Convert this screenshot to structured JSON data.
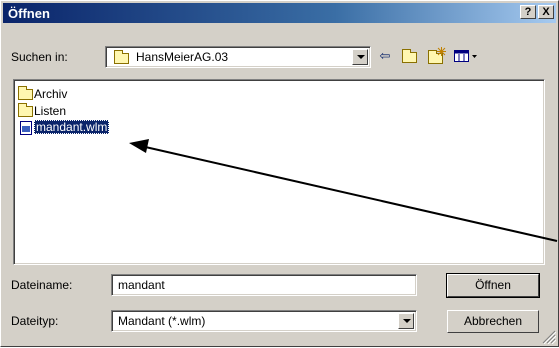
{
  "window": {
    "title": "Öffnen",
    "help_btn": "?",
    "close_btn": "X"
  },
  "lookin": {
    "label": "Suchen in:",
    "value": "HansMeierAG.03"
  },
  "toolbar": {
    "back_icon": "back-arrow-icon",
    "up_icon": "up-folder-icon",
    "new_folder_icon": "new-folder-icon",
    "view_icon": "view-menu-icon",
    "back_glyph": "⇦",
    "up_glyph": "⮤"
  },
  "files": [
    {
      "name": "Archiv",
      "type": "folder"
    },
    {
      "name": "Listen",
      "type": "folder"
    },
    {
      "name": "mandant.wlm",
      "type": "file",
      "selected": true
    }
  ],
  "filename": {
    "label": "Dateiname:",
    "value": "mandant"
  },
  "filetype": {
    "label": "Dateityp:",
    "value": "Mandant (*.wlm)"
  },
  "buttons": {
    "open": "Öffnen",
    "cancel": "Abbrechen"
  },
  "colors": {
    "selection": "#0a246a",
    "face": "#d4d0c8",
    "title_start": "#0a246a",
    "title_end": "#a6caf0"
  }
}
